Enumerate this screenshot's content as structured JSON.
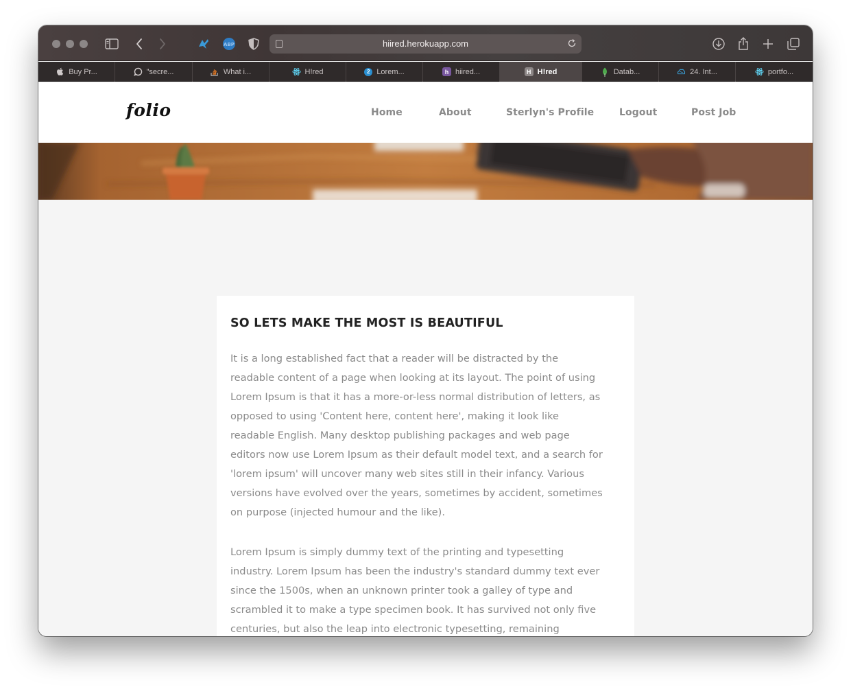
{
  "browser": {
    "url": "hiired.herokuapp.com",
    "tabs": [
      {
        "label": "Buy Pr...",
        "icon": "apple-icon"
      },
      {
        "label": "\"secre...",
        "icon": "chat-bubble-icon"
      },
      {
        "label": "What i...",
        "icon": "stackoverflow-icon"
      },
      {
        "label": "H!red",
        "icon": "react-icon"
      },
      {
        "label": "Lorem...",
        "icon": "lorem-icon"
      },
      {
        "label": "hiired...",
        "icon": "heroku-icon"
      },
      {
        "label": "H!red",
        "icon": "h-icon",
        "active": true
      },
      {
        "label": "Datab...",
        "icon": "leaf-icon"
      },
      {
        "label": "24. Int...",
        "icon": "brain-icon"
      },
      {
        "label": "portfo...",
        "icon": "react-icon"
      }
    ]
  },
  "site": {
    "logo": "folio",
    "nav": [
      "Home",
      "About",
      "Sterlyn's Profile",
      "Logout",
      "Post Job"
    ],
    "heading": "SO LETS MAKE THE MOST IS BEAUTIFUL",
    "paragraph1": [
      "It is a long established fact that a reader will be distracted by the",
      "readable content of a page when looking at its layout. The point of using",
      "Lorem Ipsum is that it has a more-or-less normal distribution of letters, as",
      "opposed to using 'Content here, content here', making it look like",
      "readable English. Many desktop publishing packages and web page",
      "editors now use Lorem Ipsum as their default model text, and a search for",
      "'lorem ipsum' will uncover many web sites still in their infancy. Various",
      "versions have evolved over the years, sometimes by accident, sometimes",
      "on purpose (injected humour and the like)."
    ],
    "paragraph2": [
      "Lorem Ipsum is simply dummy text of the printing and typesetting",
      "industry. Lorem Ipsum has been the industry's standard dummy text ever",
      "since the 1500s, when an unknown printer took a galley of type and",
      "scrambled it to make a type specimen book. It has survived not only five",
      "centuries, but also the leap into electronic typesetting, remaining"
    ]
  },
  "colors": {
    "toolbar": "#453d3d",
    "tabbar": "#2f2a2a",
    "page_bg": "#f5f5f5",
    "nav_text": "#8a8a8a",
    "body_text": "#8a8a8a",
    "heading": "#222222"
  }
}
